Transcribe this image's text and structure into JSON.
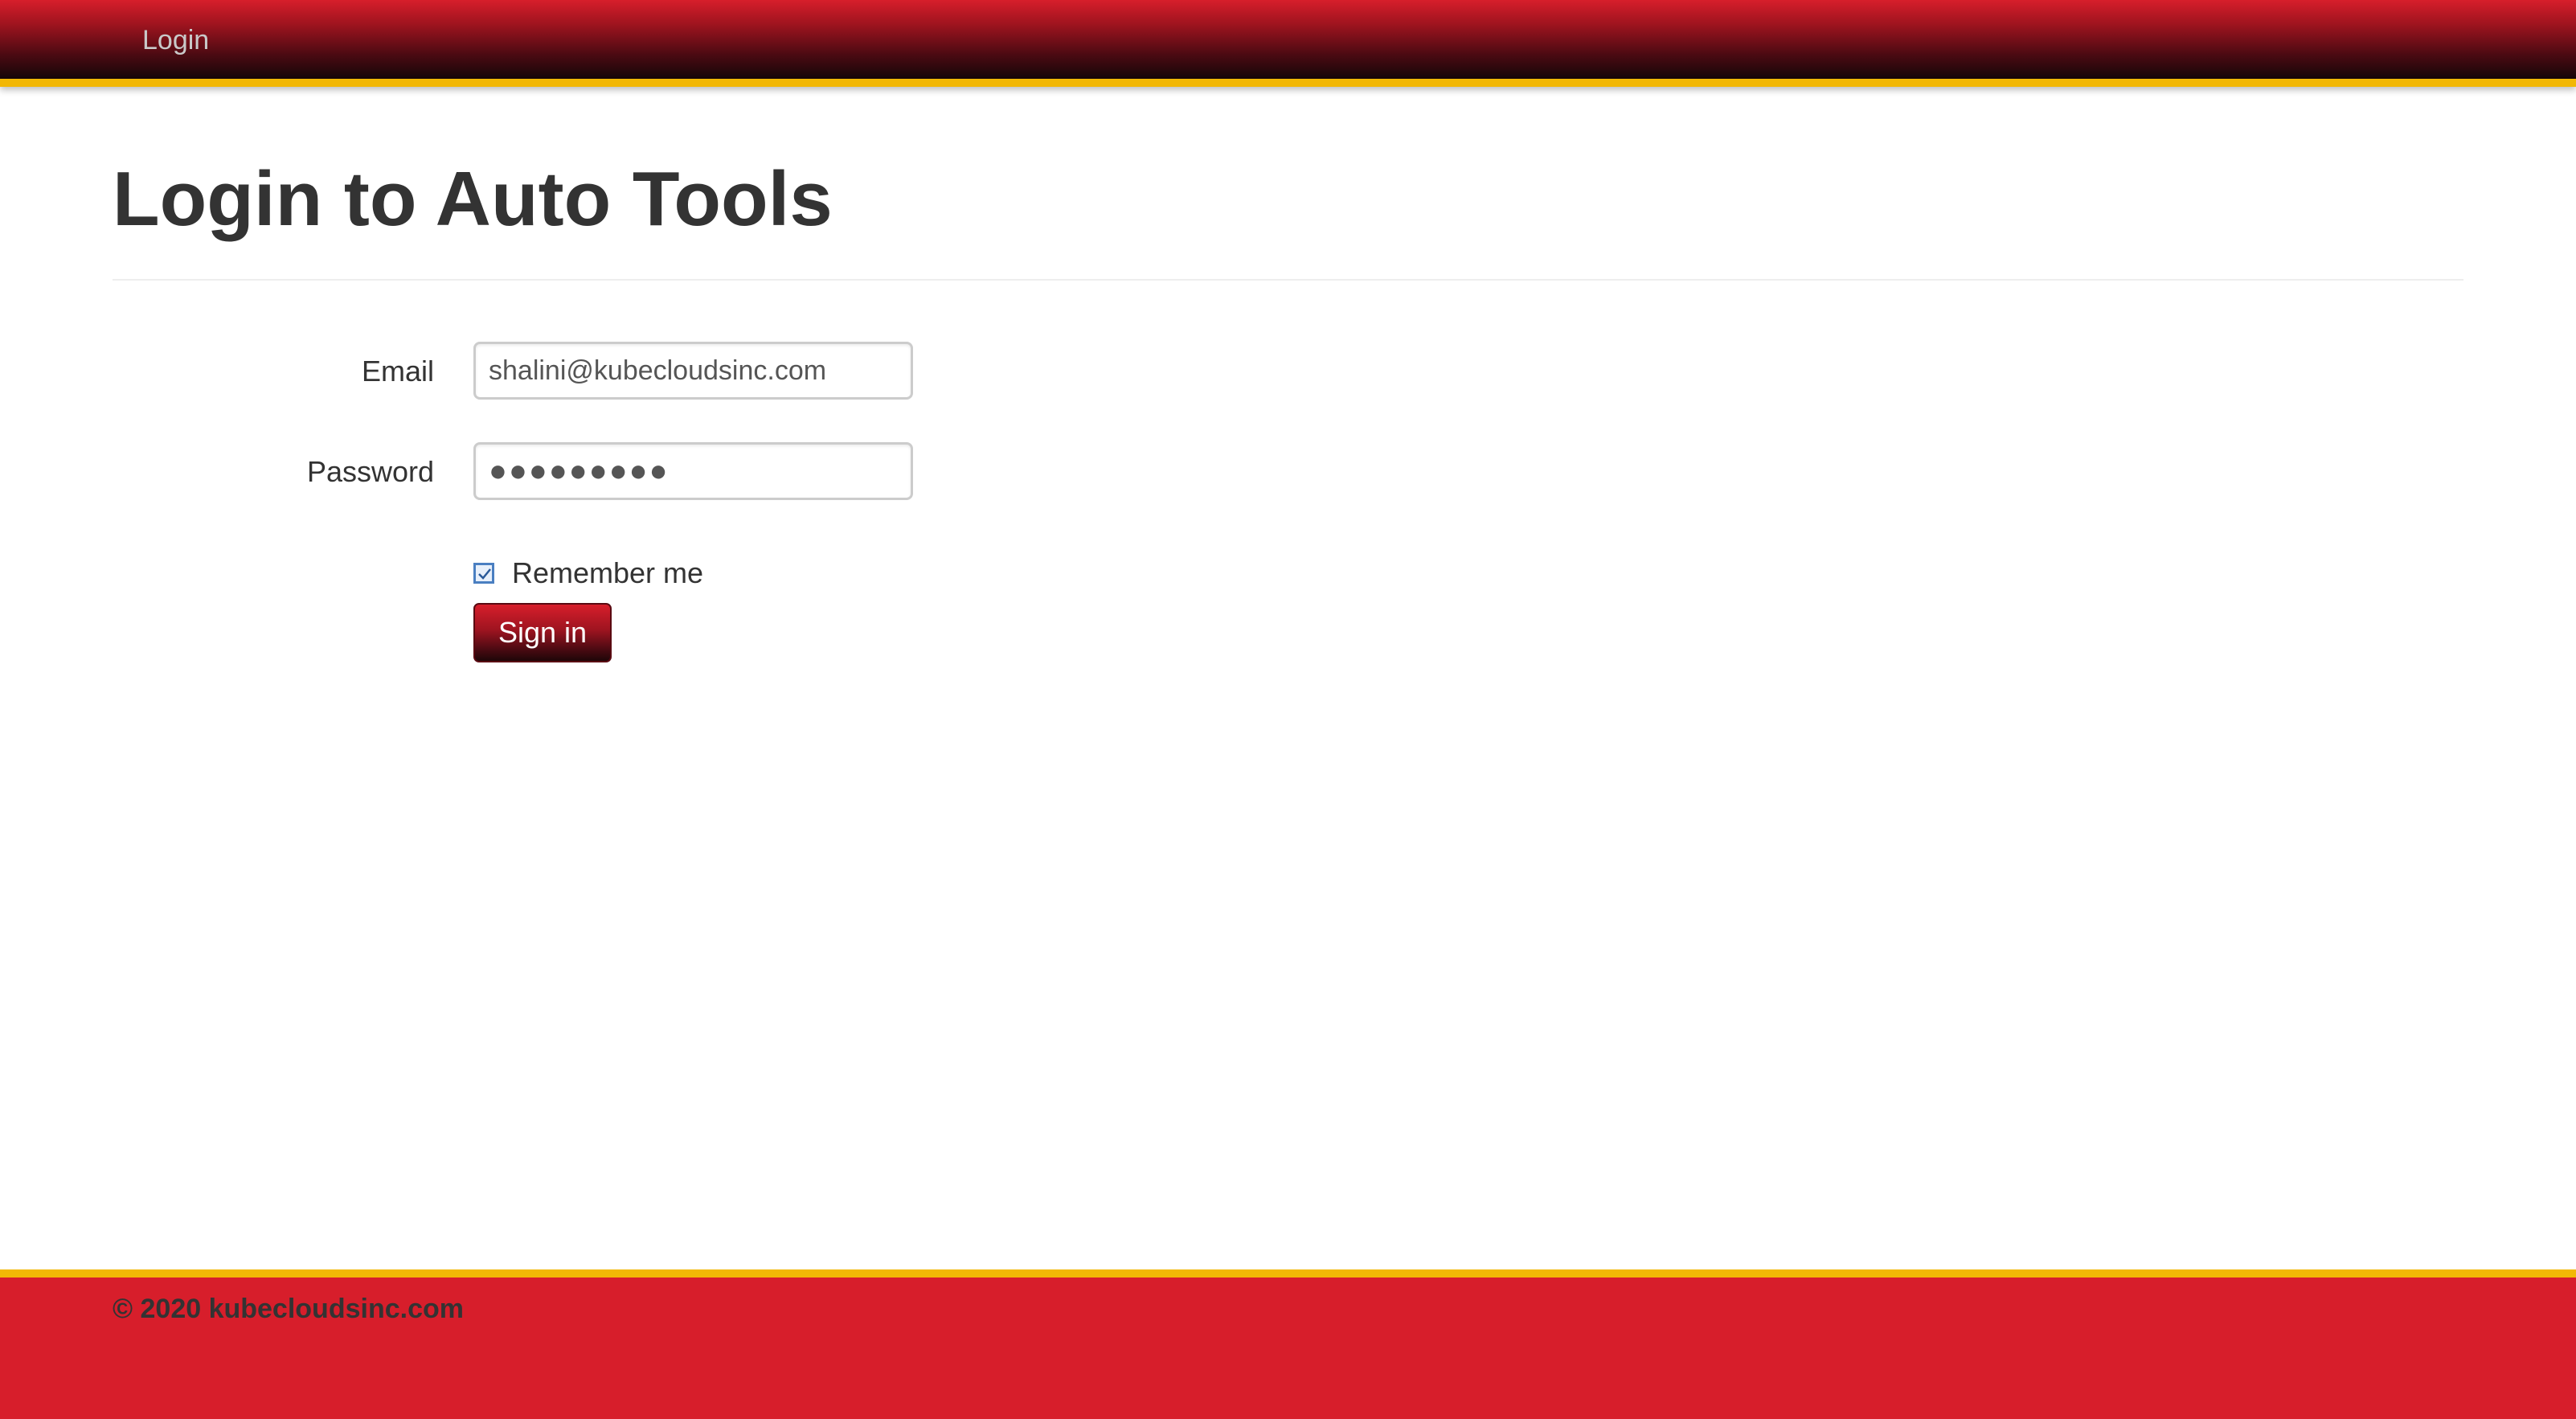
{
  "navbar": {
    "link_label": "Login",
    "accent_color": "#d71e2b",
    "border_color": "#f2b705"
  },
  "main": {
    "title": "Login to Auto Tools",
    "form": {
      "email_label": "Email",
      "email_value": "shalini@kubecloudsinc.com",
      "password_label": "Password",
      "password_value": "●●●●●●●●●",
      "remember_label": "Remember me",
      "remember_checked": true,
      "signin_label": "Sign in"
    }
  },
  "footer": {
    "text": "© 2020 kubecloudsinc.com"
  },
  "icons": {
    "checkbox": "check-icon"
  }
}
